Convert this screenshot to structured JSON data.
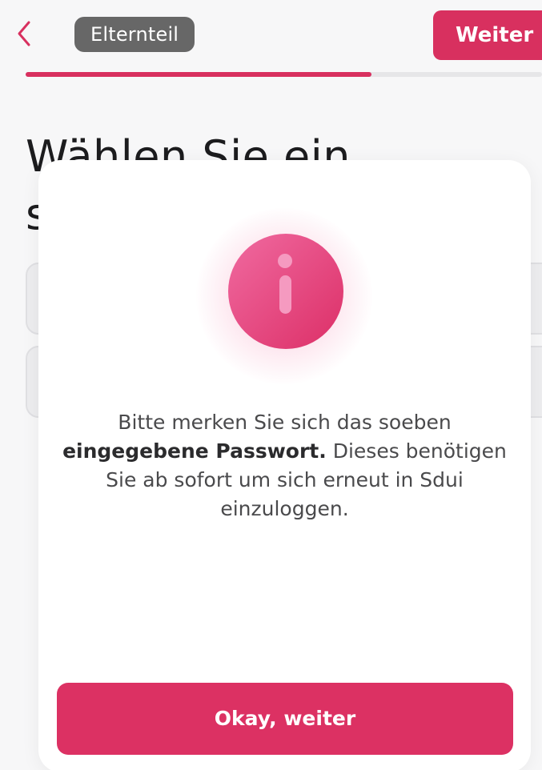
{
  "header": {
    "back_icon": "chevron-left-icon",
    "role_label": "Elternteil",
    "next_label": "Weiter",
    "progress": 0.67,
    "accent": "#d8305f"
  },
  "page": {
    "heading": "Wählen Sie ein sicheres P"
  },
  "dialog": {
    "icon": "info-icon",
    "message_part1": "Bitte merken Sie sich das soeben ",
    "message_bold": "eingegebene Passwort.",
    "message_part2": " Dieses benötigen Sie ab sofort um sich erneut in Sdui einzuloggen.",
    "button_label": "Okay, weiter"
  }
}
